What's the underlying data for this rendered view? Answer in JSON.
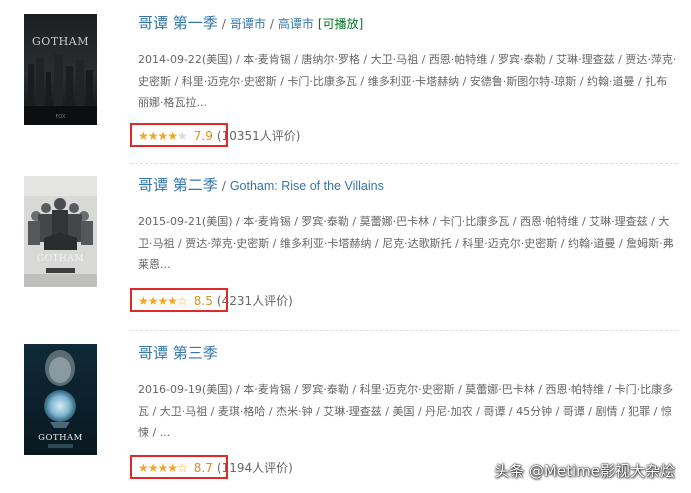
{
  "results": [
    {
      "title": "哥谭 第一季",
      "alt_titles": [
        "哥谭市",
        "高谭市"
      ],
      "playable": "[可播放]",
      "meta": "2014-09-22(美国) / 本·麦肯锡 / 唐纳尔·罗格 / 大卫·马祖 / 西恩·帕特维 / 罗宾·泰勒 / 艾琳·理查兹 / 贾达·萍克·史密斯 / 科里·迈克尔·史密斯 / 卡门·比康多瓦 / 维多利亚·卡塔赫纳 / 安德鲁·斯图尔特-琼斯 / 约翰·道曼 / 扎布丽娜·格瓦拉...",
      "stars": "4",
      "score": "7.9",
      "votes": "(10351人评价)"
    },
    {
      "title": "哥谭 第二季",
      "alt_titles": [
        "Gotham: Rise of the Villains"
      ],
      "playable": "",
      "meta": "2015-09-21(美国) / 本·麦肯锡 / 罗宾·泰勒 / 莫蕾娜·巴卡林 / 卡门·比康多瓦 / 西恩·帕特维 / 艾琳·理查兹 / 大卫·马祖 / 贾达·萍克·史密斯 / 维多利亚·卡塔赫纳 / 尼克·达歌斯托 / 科里·迈克尔·史密斯 / 约翰·道曼 / 詹姆斯·弗莱恩...",
      "stars": "4.5",
      "score": "8.5",
      "votes": "(4231人评价)"
    },
    {
      "title": "哥谭 第三季",
      "alt_titles": [],
      "playable": "",
      "meta": "2016-09-19(美国) / 本·麦肯锡 / 罗宾·泰勒 / 科里·迈克尔·史密斯 / 莫蕾娜·巴卡林 / 西恩·帕特维 / 卡门·比康多瓦 / 大卫·马祖 / 麦琪·格哈 / 杰米·钟 / 艾琳·理查兹 / 美国 / 丹尼·加农 / 哥谭 / 45分钟 / 哥谭 / 剧情 / 犯罪 / 惊悚 / ...",
      "stars": "4.5",
      "score": "8.7",
      "votes": "(1194人评价)"
    }
  ],
  "posters": [
    {
      "logo_text": "GOTHAM",
      "icon": "gotham-poster-icon"
    },
    {
      "logo_text": "GOTHAM",
      "icon": "gotham-poster-icon"
    },
    {
      "logo_text": "GOTHAM",
      "icon": "gotham-poster-icon"
    }
  ],
  "watermark": "头条 @Metime影视大杂烩",
  "colors": {
    "title_link": "#3377aa",
    "playable": "#007722",
    "star": "#f5a623",
    "score": "#e09015",
    "highlight_box": "#e02a2a"
  }
}
